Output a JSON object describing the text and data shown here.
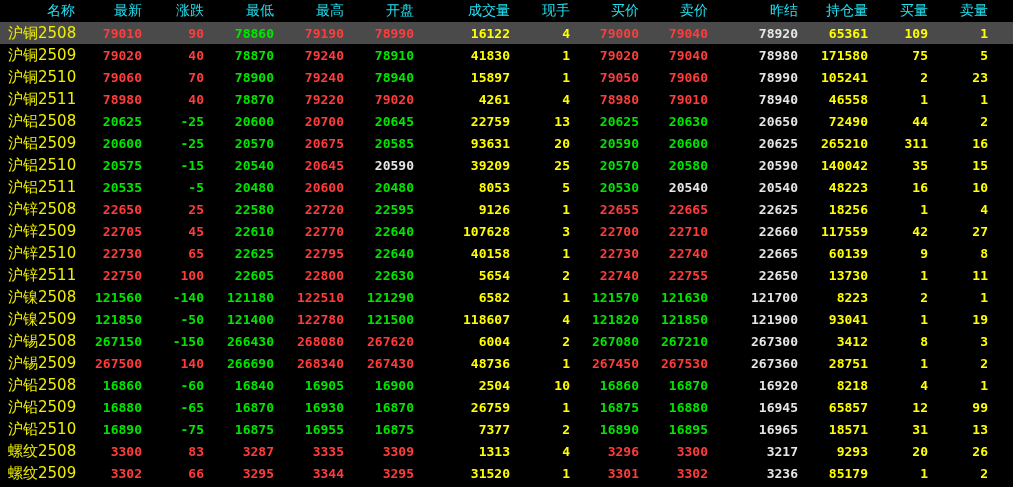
{
  "columns": [
    "名称",
    "最新",
    "涨跌",
    "最低",
    "最高",
    "开盘",
    "成交量",
    "现手",
    "买价",
    "卖价",
    "昨结",
    "持仓量",
    "买量",
    "卖量"
  ],
  "rows": [
    {
      "name": "沪铜2508",
      "selected": true,
      "cells": [
        {
          "v": "79010",
          "color": "#ff3c3c"
        },
        {
          "v": "90",
          "color": "#ff3c3c"
        },
        {
          "v": "78860",
          "color": "#00e600"
        },
        {
          "v": "79190",
          "color": "#ff3c3c"
        },
        {
          "v": "78990",
          "color": "#ff3c3c"
        },
        {
          "v": "16122",
          "color": "#ffff00"
        },
        {
          "v": "4",
          "color": "#ffff00"
        },
        {
          "v": "79000",
          "color": "#ff3c3c"
        },
        {
          "v": "79040",
          "color": "#ff3c3c"
        },
        {
          "v": "78920",
          "color": "#e6e6e6"
        },
        {
          "v": "65361",
          "color": "#ffff00"
        },
        {
          "v": "109",
          "color": "#ffff00"
        },
        {
          "v": "1",
          "color": "#ffff00"
        }
      ]
    },
    {
      "name": "沪铜2509",
      "selected": false,
      "cells": [
        {
          "v": "79020",
          "color": "#ff3c3c"
        },
        {
          "v": "40",
          "color": "#ff3c3c"
        },
        {
          "v": "78870",
          "color": "#00e600"
        },
        {
          "v": "79240",
          "color": "#ff3c3c"
        },
        {
          "v": "78910",
          "color": "#00e600"
        },
        {
          "v": "41830",
          "color": "#ffff00"
        },
        {
          "v": "1",
          "color": "#ffff00"
        },
        {
          "v": "79020",
          "color": "#ff3c3c"
        },
        {
          "v": "79040",
          "color": "#ff3c3c"
        },
        {
          "v": "78980",
          "color": "#e6e6e6"
        },
        {
          "v": "171580",
          "color": "#ffff00"
        },
        {
          "v": "75",
          "color": "#ffff00"
        },
        {
          "v": "5",
          "color": "#ffff00"
        }
      ]
    },
    {
      "name": "沪铜2510",
      "selected": false,
      "cells": [
        {
          "v": "79060",
          "color": "#ff3c3c"
        },
        {
          "v": "70",
          "color": "#ff3c3c"
        },
        {
          "v": "78900",
          "color": "#00e600"
        },
        {
          "v": "79240",
          "color": "#ff3c3c"
        },
        {
          "v": "78940",
          "color": "#00e600"
        },
        {
          "v": "15897",
          "color": "#ffff00"
        },
        {
          "v": "1",
          "color": "#ffff00"
        },
        {
          "v": "79050",
          "color": "#ff3c3c"
        },
        {
          "v": "79060",
          "color": "#ff3c3c"
        },
        {
          "v": "78990",
          "color": "#e6e6e6"
        },
        {
          "v": "105241",
          "color": "#ffff00"
        },
        {
          "v": "2",
          "color": "#ffff00"
        },
        {
          "v": "23",
          "color": "#ffff00"
        }
      ]
    },
    {
      "name": "沪铜2511",
      "selected": false,
      "cells": [
        {
          "v": "78980",
          "color": "#ff3c3c"
        },
        {
          "v": "40",
          "color": "#ff3c3c"
        },
        {
          "v": "78870",
          "color": "#00e600"
        },
        {
          "v": "79220",
          "color": "#ff3c3c"
        },
        {
          "v": "79020",
          "color": "#ff3c3c"
        },
        {
          "v": "4261",
          "color": "#ffff00"
        },
        {
          "v": "4",
          "color": "#ffff00"
        },
        {
          "v": "78980",
          "color": "#ff3c3c"
        },
        {
          "v": "79010",
          "color": "#ff3c3c"
        },
        {
          "v": "78940",
          "color": "#e6e6e6"
        },
        {
          "v": "46558",
          "color": "#ffff00"
        },
        {
          "v": "1",
          "color": "#ffff00"
        },
        {
          "v": "1",
          "color": "#ffff00"
        }
      ]
    },
    {
      "name": "沪铝2508",
      "selected": false,
      "cells": [
        {
          "v": "20625",
          "color": "#00e600"
        },
        {
          "v": "-25",
          "color": "#00e600"
        },
        {
          "v": "20600",
          "color": "#00e600"
        },
        {
          "v": "20700",
          "color": "#ff3c3c"
        },
        {
          "v": "20645",
          "color": "#00e600"
        },
        {
          "v": "22759",
          "color": "#ffff00"
        },
        {
          "v": "13",
          "color": "#ffff00"
        },
        {
          "v": "20625",
          "color": "#00e600"
        },
        {
          "v": "20630",
          "color": "#00e600"
        },
        {
          "v": "20650",
          "color": "#e6e6e6"
        },
        {
          "v": "72490",
          "color": "#ffff00"
        },
        {
          "v": "44",
          "color": "#ffff00"
        },
        {
          "v": "2",
          "color": "#ffff00"
        }
      ]
    },
    {
      "name": "沪铝2509",
      "selected": false,
      "cells": [
        {
          "v": "20600",
          "color": "#00e600"
        },
        {
          "v": "-25",
          "color": "#00e600"
        },
        {
          "v": "20570",
          "color": "#00e600"
        },
        {
          "v": "20675",
          "color": "#ff3c3c"
        },
        {
          "v": "20585",
          "color": "#00e600"
        },
        {
          "v": "93631",
          "color": "#ffff00"
        },
        {
          "v": "20",
          "color": "#ffff00"
        },
        {
          "v": "20590",
          "color": "#00e600"
        },
        {
          "v": "20600",
          "color": "#00e600"
        },
        {
          "v": "20625",
          "color": "#e6e6e6"
        },
        {
          "v": "265210",
          "color": "#ffff00"
        },
        {
          "v": "311",
          "color": "#ffff00"
        },
        {
          "v": "16",
          "color": "#ffff00"
        }
      ]
    },
    {
      "name": "沪铝2510",
      "selected": false,
      "cells": [
        {
          "v": "20575",
          "color": "#00e600"
        },
        {
          "v": "-15",
          "color": "#00e600"
        },
        {
          "v": "20540",
          "color": "#00e600"
        },
        {
          "v": "20645",
          "color": "#ff3c3c"
        },
        {
          "v": "20590",
          "color": "#e6e6e6"
        },
        {
          "v": "39209",
          "color": "#ffff00"
        },
        {
          "v": "25",
          "color": "#ffff00"
        },
        {
          "v": "20570",
          "color": "#00e600"
        },
        {
          "v": "20580",
          "color": "#00e600"
        },
        {
          "v": "20590",
          "color": "#e6e6e6"
        },
        {
          "v": "140042",
          "color": "#ffff00"
        },
        {
          "v": "35",
          "color": "#ffff00"
        },
        {
          "v": "15",
          "color": "#ffff00"
        }
      ]
    },
    {
      "name": "沪铝2511",
      "selected": false,
      "cells": [
        {
          "v": "20535",
          "color": "#00e600"
        },
        {
          "v": "-5",
          "color": "#00e600"
        },
        {
          "v": "20480",
          "color": "#00e600"
        },
        {
          "v": "20600",
          "color": "#ff3c3c"
        },
        {
          "v": "20480",
          "color": "#00e600"
        },
        {
          "v": "8053",
          "color": "#ffff00"
        },
        {
          "v": "5",
          "color": "#ffff00"
        },
        {
          "v": "20530",
          "color": "#00e600"
        },
        {
          "v": "20540",
          "color": "#e6e6e6"
        },
        {
          "v": "20540",
          "color": "#e6e6e6"
        },
        {
          "v": "48223",
          "color": "#ffff00"
        },
        {
          "v": "16",
          "color": "#ffff00"
        },
        {
          "v": "10",
          "color": "#ffff00"
        }
      ]
    },
    {
      "name": "沪锌2508",
      "selected": false,
      "cells": [
        {
          "v": "22650",
          "color": "#ff3c3c"
        },
        {
          "v": "25",
          "color": "#ff3c3c"
        },
        {
          "v": "22580",
          "color": "#00e600"
        },
        {
          "v": "22720",
          "color": "#ff3c3c"
        },
        {
          "v": "22595",
          "color": "#00e600"
        },
        {
          "v": "9126",
          "color": "#ffff00"
        },
        {
          "v": "1",
          "color": "#ffff00"
        },
        {
          "v": "22655",
          "color": "#ff3c3c"
        },
        {
          "v": "22665",
          "color": "#ff3c3c"
        },
        {
          "v": "22625",
          "color": "#e6e6e6"
        },
        {
          "v": "18256",
          "color": "#ffff00"
        },
        {
          "v": "1",
          "color": "#ffff00"
        },
        {
          "v": "4",
          "color": "#ffff00"
        }
      ]
    },
    {
      "name": "沪锌2509",
      "selected": false,
      "cells": [
        {
          "v": "22705",
          "color": "#ff3c3c"
        },
        {
          "v": "45",
          "color": "#ff3c3c"
        },
        {
          "v": "22610",
          "color": "#00e600"
        },
        {
          "v": "22770",
          "color": "#ff3c3c"
        },
        {
          "v": "22640",
          "color": "#00e600"
        },
        {
          "v": "107628",
          "color": "#ffff00"
        },
        {
          "v": "3",
          "color": "#ffff00"
        },
        {
          "v": "22700",
          "color": "#ff3c3c"
        },
        {
          "v": "22710",
          "color": "#ff3c3c"
        },
        {
          "v": "22660",
          "color": "#e6e6e6"
        },
        {
          "v": "117559",
          "color": "#ffff00"
        },
        {
          "v": "42",
          "color": "#ffff00"
        },
        {
          "v": "27",
          "color": "#ffff00"
        }
      ]
    },
    {
      "name": "沪锌2510",
      "selected": false,
      "cells": [
        {
          "v": "22730",
          "color": "#ff3c3c"
        },
        {
          "v": "65",
          "color": "#ff3c3c"
        },
        {
          "v": "22625",
          "color": "#00e600"
        },
        {
          "v": "22795",
          "color": "#ff3c3c"
        },
        {
          "v": "22640",
          "color": "#00e600"
        },
        {
          "v": "40158",
          "color": "#ffff00"
        },
        {
          "v": "1",
          "color": "#ffff00"
        },
        {
          "v": "22730",
          "color": "#ff3c3c"
        },
        {
          "v": "22740",
          "color": "#ff3c3c"
        },
        {
          "v": "22665",
          "color": "#e6e6e6"
        },
        {
          "v": "60139",
          "color": "#ffff00"
        },
        {
          "v": "9",
          "color": "#ffff00"
        },
        {
          "v": "8",
          "color": "#ffff00"
        }
      ]
    },
    {
      "name": "沪锌2511",
      "selected": false,
      "cells": [
        {
          "v": "22750",
          "color": "#ff3c3c"
        },
        {
          "v": "100",
          "color": "#ff3c3c"
        },
        {
          "v": "22605",
          "color": "#00e600"
        },
        {
          "v": "22800",
          "color": "#ff3c3c"
        },
        {
          "v": "22630",
          "color": "#00e600"
        },
        {
          "v": "5654",
          "color": "#ffff00"
        },
        {
          "v": "2",
          "color": "#ffff00"
        },
        {
          "v": "22740",
          "color": "#ff3c3c"
        },
        {
          "v": "22755",
          "color": "#ff3c3c"
        },
        {
          "v": "22650",
          "color": "#e6e6e6"
        },
        {
          "v": "13730",
          "color": "#ffff00"
        },
        {
          "v": "1",
          "color": "#ffff00"
        },
        {
          "v": "11",
          "color": "#ffff00"
        }
      ]
    },
    {
      "name": "沪镍2508",
      "selected": false,
      "cells": [
        {
          "v": "121560",
          "color": "#00e600"
        },
        {
          "v": "-140",
          "color": "#00e600"
        },
        {
          "v": "121180",
          "color": "#00e600"
        },
        {
          "v": "122510",
          "color": "#ff3c3c"
        },
        {
          "v": "121290",
          "color": "#00e600"
        },
        {
          "v": "6582",
          "color": "#ffff00"
        },
        {
          "v": "1",
          "color": "#ffff00"
        },
        {
          "v": "121570",
          "color": "#00e600"
        },
        {
          "v": "121630",
          "color": "#00e600"
        },
        {
          "v": "121700",
          "color": "#e6e6e6"
        },
        {
          "v": "8223",
          "color": "#ffff00"
        },
        {
          "v": "2",
          "color": "#ffff00"
        },
        {
          "v": "1",
          "color": "#ffff00"
        }
      ]
    },
    {
      "name": "沪镍2509",
      "selected": false,
      "cells": [
        {
          "v": "121850",
          "color": "#00e600"
        },
        {
          "v": "-50",
          "color": "#00e600"
        },
        {
          "v": "121400",
          "color": "#00e600"
        },
        {
          "v": "122780",
          "color": "#ff3c3c"
        },
        {
          "v": "121500",
          "color": "#00e600"
        },
        {
          "v": "118607",
          "color": "#ffff00"
        },
        {
          "v": "4",
          "color": "#ffff00"
        },
        {
          "v": "121820",
          "color": "#00e600"
        },
        {
          "v": "121850",
          "color": "#00e600"
        },
        {
          "v": "121900",
          "color": "#e6e6e6"
        },
        {
          "v": "93041",
          "color": "#ffff00"
        },
        {
          "v": "1",
          "color": "#ffff00"
        },
        {
          "v": "19",
          "color": "#ffff00"
        }
      ]
    },
    {
      "name": "沪锡2508",
      "selected": false,
      "cells": [
        {
          "v": "267150",
          "color": "#00e600"
        },
        {
          "v": "-150",
          "color": "#00e600"
        },
        {
          "v": "266430",
          "color": "#00e600"
        },
        {
          "v": "268080",
          "color": "#ff3c3c"
        },
        {
          "v": "267620",
          "color": "#ff3c3c"
        },
        {
          "v": "6004",
          "color": "#ffff00"
        },
        {
          "v": "2",
          "color": "#ffff00"
        },
        {
          "v": "267080",
          "color": "#00e600"
        },
        {
          "v": "267210",
          "color": "#00e600"
        },
        {
          "v": "267300",
          "color": "#e6e6e6"
        },
        {
          "v": "3412",
          "color": "#ffff00"
        },
        {
          "v": "8",
          "color": "#ffff00"
        },
        {
          "v": "3",
          "color": "#ffff00"
        }
      ]
    },
    {
      "name": "沪锡2509",
      "selected": false,
      "cells": [
        {
          "v": "267500",
          "color": "#ff3c3c"
        },
        {
          "v": "140",
          "color": "#ff3c3c"
        },
        {
          "v": "266690",
          "color": "#00e600"
        },
        {
          "v": "268340",
          "color": "#ff3c3c"
        },
        {
          "v": "267430",
          "color": "#ff3c3c"
        },
        {
          "v": "48736",
          "color": "#ffff00"
        },
        {
          "v": "1",
          "color": "#ffff00"
        },
        {
          "v": "267450",
          "color": "#ff3c3c"
        },
        {
          "v": "267530",
          "color": "#ff3c3c"
        },
        {
          "v": "267360",
          "color": "#e6e6e6"
        },
        {
          "v": "28751",
          "color": "#ffff00"
        },
        {
          "v": "1",
          "color": "#ffff00"
        },
        {
          "v": "2",
          "color": "#ffff00"
        }
      ]
    },
    {
      "name": "沪铅2508",
      "selected": false,
      "cells": [
        {
          "v": "16860",
          "color": "#00e600"
        },
        {
          "v": "-60",
          "color": "#00e600"
        },
        {
          "v": "16840",
          "color": "#00e600"
        },
        {
          "v": "16905",
          "color": "#00e600"
        },
        {
          "v": "16900",
          "color": "#00e600"
        },
        {
          "v": "2504",
          "color": "#ffff00"
        },
        {
          "v": "10",
          "color": "#ffff00"
        },
        {
          "v": "16860",
          "color": "#00e600"
        },
        {
          "v": "16870",
          "color": "#00e600"
        },
        {
          "v": "16920",
          "color": "#e6e6e6"
        },
        {
          "v": "8218",
          "color": "#ffff00"
        },
        {
          "v": "4",
          "color": "#ffff00"
        },
        {
          "v": "1",
          "color": "#ffff00"
        }
      ]
    },
    {
      "name": "沪铅2509",
      "selected": false,
      "cells": [
        {
          "v": "16880",
          "color": "#00e600"
        },
        {
          "v": "-65",
          "color": "#00e600"
        },
        {
          "v": "16870",
          "color": "#00e600"
        },
        {
          "v": "16930",
          "color": "#00e600"
        },
        {
          "v": "16870",
          "color": "#00e600"
        },
        {
          "v": "26759",
          "color": "#ffff00"
        },
        {
          "v": "1",
          "color": "#ffff00"
        },
        {
          "v": "16875",
          "color": "#00e600"
        },
        {
          "v": "16880",
          "color": "#00e600"
        },
        {
          "v": "16945",
          "color": "#e6e6e6"
        },
        {
          "v": "65857",
          "color": "#ffff00"
        },
        {
          "v": "12",
          "color": "#ffff00"
        },
        {
          "v": "99",
          "color": "#ffff00"
        }
      ]
    },
    {
      "name": "沪铅2510",
      "selected": false,
      "cells": [
        {
          "v": "16890",
          "color": "#00e600"
        },
        {
          "v": "-75",
          "color": "#00e600"
        },
        {
          "v": "16875",
          "color": "#00e600"
        },
        {
          "v": "16955",
          "color": "#00e600"
        },
        {
          "v": "16875",
          "color": "#00e600"
        },
        {
          "v": "7377",
          "color": "#ffff00"
        },
        {
          "v": "2",
          "color": "#ffff00"
        },
        {
          "v": "16890",
          "color": "#00e600"
        },
        {
          "v": "16895",
          "color": "#00e600"
        },
        {
          "v": "16965",
          "color": "#e6e6e6"
        },
        {
          "v": "18571",
          "color": "#ffff00"
        },
        {
          "v": "31",
          "color": "#ffff00"
        },
        {
          "v": "13",
          "color": "#ffff00"
        }
      ]
    },
    {
      "name": "螺纹2508",
      "selected": false,
      "cells": [
        {
          "v": "3300",
          "color": "#ff3c3c"
        },
        {
          "v": "83",
          "color": "#ff3c3c"
        },
        {
          "v": "3287",
          "color": "#ff3c3c"
        },
        {
          "v": "3335",
          "color": "#ff3c3c"
        },
        {
          "v": "3309",
          "color": "#ff3c3c"
        },
        {
          "v": "1313",
          "color": "#ffff00"
        },
        {
          "v": "4",
          "color": "#ffff00"
        },
        {
          "v": "3296",
          "color": "#ff3c3c"
        },
        {
          "v": "3300",
          "color": "#ff3c3c"
        },
        {
          "v": "3217",
          "color": "#e6e6e6"
        },
        {
          "v": "9293",
          "color": "#ffff00"
        },
        {
          "v": "20",
          "color": "#ffff00"
        },
        {
          "v": "26",
          "color": "#ffff00"
        }
      ]
    },
    {
      "name": "螺纹2509",
      "selected": false,
      "cells": [
        {
          "v": "3302",
          "color": "#ff3c3c"
        },
        {
          "v": "66",
          "color": "#ff3c3c"
        },
        {
          "v": "3295",
          "color": "#ff3c3c"
        },
        {
          "v": "3344",
          "color": "#ff3c3c"
        },
        {
          "v": "3295",
          "color": "#ff3c3c"
        },
        {
          "v": "31520",
          "color": "#ffff00"
        },
        {
          "v": "1",
          "color": "#ffff00"
        },
        {
          "v": "3301",
          "color": "#ff3c3c"
        },
        {
          "v": "3302",
          "color": "#ff3c3c"
        },
        {
          "v": "3236",
          "color": "#e6e6e6"
        },
        {
          "v": "85179",
          "color": "#ffff00"
        },
        {
          "v": "1",
          "color": "#ffff00"
        },
        {
          "v": "2",
          "color": "#ffff00"
        }
      ]
    }
  ]
}
